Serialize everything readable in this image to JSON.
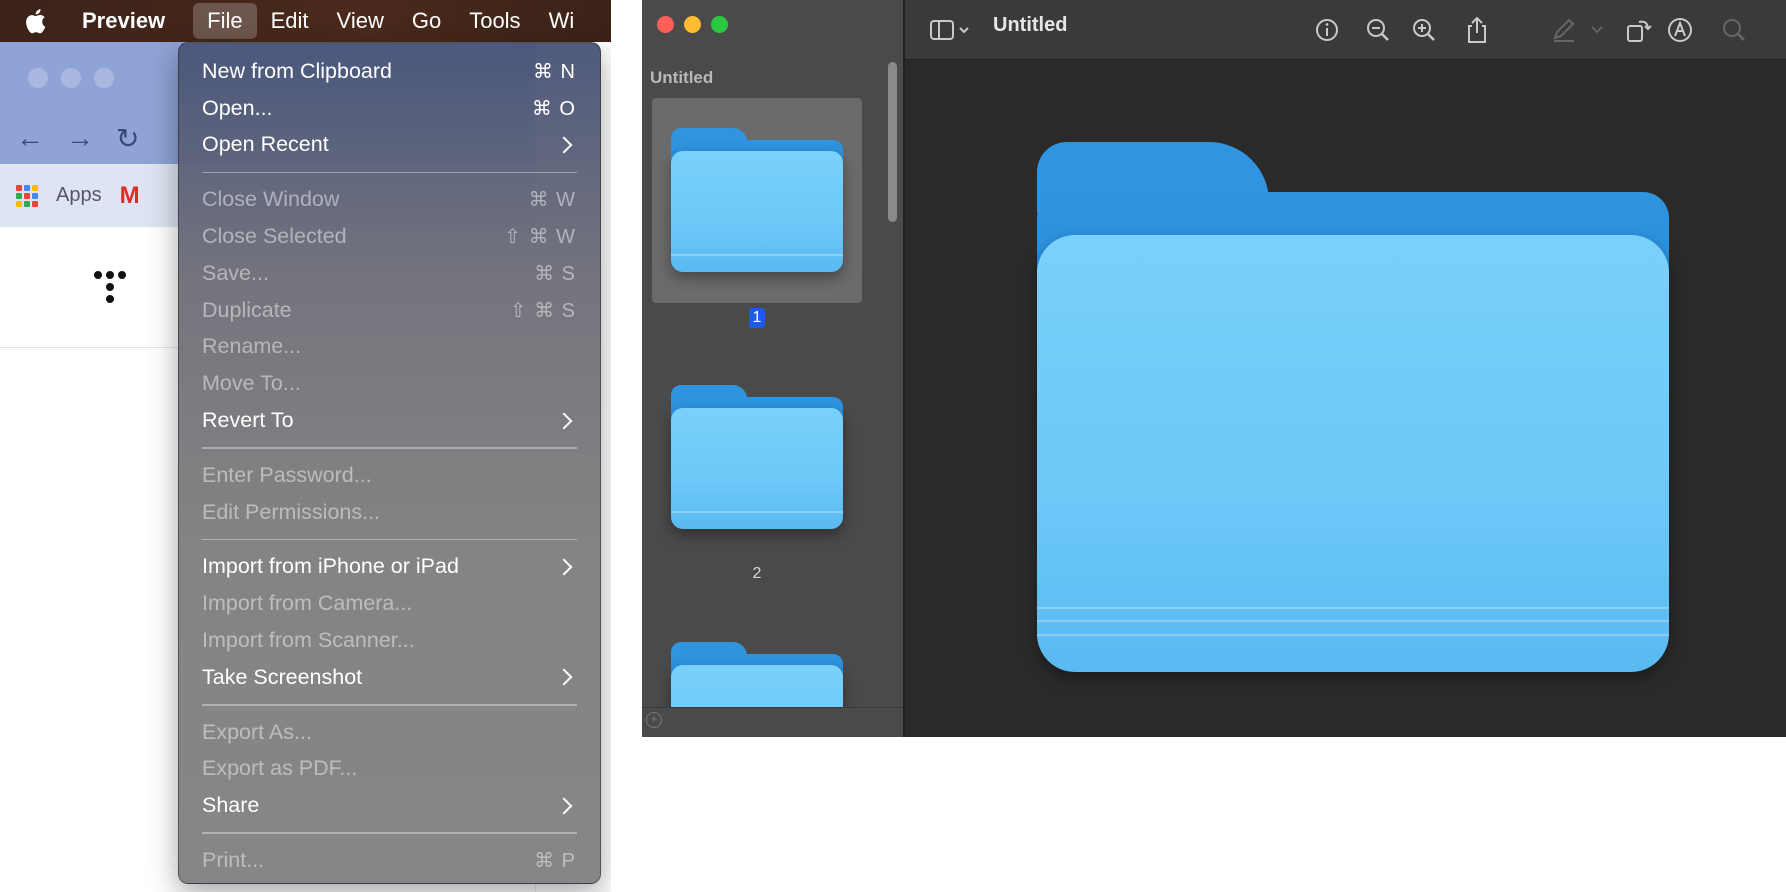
{
  "menubar": {
    "app_name": "Preview",
    "items": [
      "File",
      "Edit",
      "View",
      "Go",
      "Tools",
      "Wi"
    ]
  },
  "browser": {
    "bookmarks_apps_label": "Apps",
    "gmail_glyph": "M"
  },
  "file_menu": {
    "items": [
      {
        "label": "New from Clipboard",
        "shortcut": "⌘ N",
        "enabled": true
      },
      {
        "label": "Open...",
        "shortcut": "⌘ O",
        "enabled": true
      },
      {
        "label": "Open Recent",
        "submenu": true,
        "enabled": true
      },
      {
        "label": "Close Window",
        "shortcut": "⌘ W",
        "enabled": false
      },
      {
        "label": "Close Selected",
        "shortcut": "⇧ ⌘ W",
        "enabled": false
      },
      {
        "label": "Save...",
        "shortcut": "⌘ S",
        "enabled": false
      },
      {
        "label": "Duplicate",
        "shortcut": "⇧ ⌘ S",
        "enabled": false
      },
      {
        "label": "Rename...",
        "enabled": false
      },
      {
        "label": "Move To...",
        "enabled": false
      },
      {
        "label": "Revert To",
        "submenu": true,
        "enabled": true
      },
      {
        "label": "Enter Password...",
        "enabled": false
      },
      {
        "label": "Edit Permissions...",
        "enabled": false
      },
      {
        "label": "Import from iPhone or iPad",
        "submenu": true,
        "enabled": true
      },
      {
        "label": "Import from Camera...",
        "enabled": false
      },
      {
        "label": "Import from Scanner...",
        "enabled": false
      },
      {
        "label": "Take Screenshot",
        "submenu": true,
        "enabled": true
      },
      {
        "label": "Export As...",
        "enabled": false
      },
      {
        "label": "Export as PDF...",
        "enabled": false
      },
      {
        "label": "Share",
        "submenu": true,
        "enabled": true
      },
      {
        "label": "Print...",
        "shortcut": "⌘ P",
        "enabled": false
      }
    ]
  },
  "preview": {
    "window_title": "Untitled",
    "sidebar_title": "Untitled",
    "pages": [
      {
        "number": "1",
        "selected": true
      },
      {
        "number": "2",
        "selected": false
      },
      {
        "number": "",
        "selected": false
      }
    ],
    "toolbar_icons": [
      "sidebar-toggle-icon",
      "info-icon",
      "zoom-out-icon",
      "zoom-in-icon",
      "share-icon",
      "markup-pen-icon",
      "rotate-icon",
      "markup-toolbar-icon",
      "search-icon"
    ]
  },
  "colors": {
    "folder_light": "#6cc8f7",
    "folder_dark": "#2282d4",
    "selection_blue": "#1a5ce6"
  }
}
